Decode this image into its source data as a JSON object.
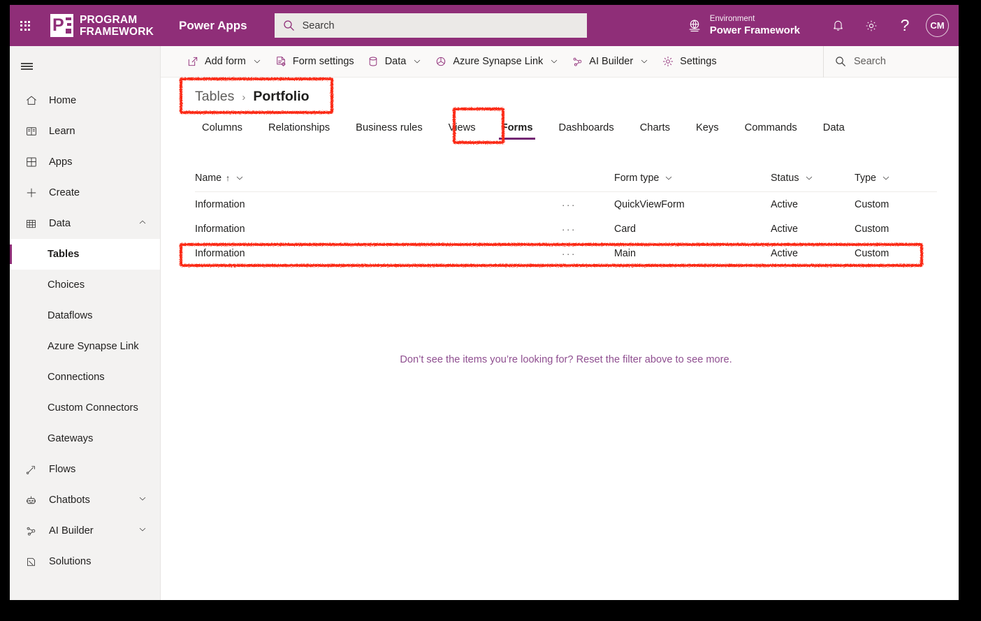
{
  "suite": {
    "waffle_icon": "waffle-icon",
    "brand_line1": "PROGRAM",
    "brand_line2": "FRAMEWORK",
    "brand_mark_text": "P",
    "app_name": "Power Apps",
    "search_placeholder": "Search",
    "environment_label": "Environment",
    "environment_name": "Power Framework",
    "notifications_icon": "bell-icon",
    "settings_icon": "gear-icon",
    "help_icon": "question-mark-icon",
    "avatar_initials": "CM",
    "header_color": "#8f2e78"
  },
  "leftnav": {
    "hamburger_icon": "hamburger-menu-icon",
    "items": [
      {
        "label": "Home",
        "icon": "home-icon",
        "level": "top",
        "active": false,
        "expandable": false
      },
      {
        "label": "Learn",
        "icon": "book-icon",
        "level": "top",
        "active": false,
        "expandable": false
      },
      {
        "label": "Apps",
        "icon": "apps-grid-icon",
        "level": "top",
        "active": false,
        "expandable": false
      },
      {
        "label": "Create",
        "icon": "plus-icon",
        "level": "top",
        "active": false,
        "expandable": false
      },
      {
        "label": "Data",
        "icon": "table-grid-icon",
        "level": "top",
        "active": false,
        "expandable": true,
        "expanded": true
      },
      {
        "label": "Tables",
        "icon": "",
        "level": "sub",
        "active": true,
        "expandable": false
      },
      {
        "label": "Choices",
        "icon": "",
        "level": "sub",
        "active": false,
        "expandable": false
      },
      {
        "label": "Dataflows",
        "icon": "",
        "level": "sub",
        "active": false,
        "expandable": false
      },
      {
        "label": "Azure Synapse Link",
        "icon": "",
        "level": "sub",
        "active": false,
        "expandable": false
      },
      {
        "label": "Connections",
        "icon": "",
        "level": "sub",
        "active": false,
        "expandable": false
      },
      {
        "label": "Custom Connectors",
        "icon": "",
        "level": "sub",
        "active": false,
        "expandable": false
      },
      {
        "label": "Gateways",
        "icon": "",
        "level": "sub",
        "active": false,
        "expandable": false
      },
      {
        "label": "Flows",
        "icon": "flow-icon",
        "level": "top",
        "active": false,
        "expandable": false
      },
      {
        "label": "Chatbots",
        "icon": "robot-icon",
        "level": "top",
        "active": false,
        "expandable": true,
        "expanded": false
      },
      {
        "label": "AI Builder",
        "icon": "ai-builder-icon",
        "level": "top",
        "active": false,
        "expandable": true,
        "expanded": false
      },
      {
        "label": "Solutions",
        "icon": "solutions-icon",
        "level": "top",
        "active": false,
        "expandable": false
      }
    ]
  },
  "commandbar": {
    "items": [
      {
        "label": "Add form",
        "icon": "add-form-icon",
        "caret": true
      },
      {
        "label": "Form settings",
        "icon": "form-settings-icon",
        "caret": false
      },
      {
        "label": "Data",
        "icon": "database-icon",
        "caret": true
      },
      {
        "label": "Azure Synapse Link",
        "icon": "synapse-icon",
        "caret": true
      },
      {
        "label": "AI Builder",
        "icon": "ai-builder-icon",
        "caret": true
      },
      {
        "label": "Settings",
        "icon": "gear-icon",
        "caret": false
      }
    ],
    "search_placeholder": "Search"
  },
  "breadcrumb": {
    "root": "Tables",
    "separator": "›",
    "current": "Portfolio"
  },
  "tabs": [
    {
      "label": "Columns",
      "active": false
    },
    {
      "label": "Relationships",
      "active": false
    },
    {
      "label": "Business rules",
      "active": false
    },
    {
      "label": "Views",
      "active": false
    },
    {
      "label": "Forms",
      "active": true
    },
    {
      "label": "Dashboards",
      "active": false
    },
    {
      "label": "Charts",
      "active": false
    },
    {
      "label": "Keys",
      "active": false
    },
    {
      "label": "Commands",
      "active": false
    },
    {
      "label": "Data",
      "active": false
    }
  ],
  "table": {
    "columns": [
      {
        "label": "Name",
        "sorted": true,
        "sort_glyph": "↑"
      },
      {
        "label": "Form type",
        "sorted": false,
        "sort_glyph": ""
      },
      {
        "label": "Status",
        "sorted": false,
        "sort_glyph": ""
      },
      {
        "label": "Type",
        "sorted": false,
        "sort_glyph": ""
      }
    ],
    "rows": [
      {
        "name": "Information",
        "form_type": "QuickViewForm",
        "status": "Active",
        "type": "Custom",
        "overflow": "···",
        "highlighted": false
      },
      {
        "name": "Information",
        "form_type": "Card",
        "status": "Active",
        "type": "Custom",
        "overflow": "···",
        "highlighted": false
      },
      {
        "name": "Information",
        "form_type": "Main",
        "status": "Active",
        "type": "Custom",
        "overflow": "···",
        "highlighted": true
      }
    ],
    "empty_message": "Don’t see the items you’re looking for? Reset the filter above to see more."
  },
  "annotations": {
    "color": "#fb2b14",
    "boxes": [
      {
        "name": "breadcrumb-highlight",
        "target": "breadcrumb"
      },
      {
        "name": "forms-tab-highlight",
        "target": "Forms"
      },
      {
        "name": "main-form-row-highlight",
        "target": "Information / Main"
      }
    ]
  }
}
